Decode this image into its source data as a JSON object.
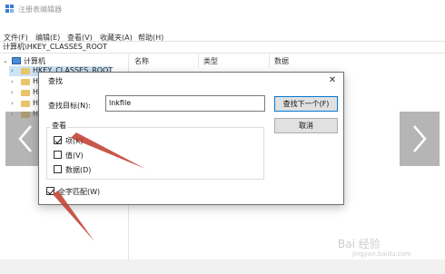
{
  "window": {
    "title": "注册表编辑器",
    "menu": [
      "文件(F)",
      "编辑(E)",
      "查看(V)",
      "收藏夹(A)",
      "帮助(H)"
    ],
    "address": "计算机\\HKEY_CLASSES_ROOT"
  },
  "tree": {
    "root": "计算机",
    "selected": "HKEY_CLASSES_ROOT",
    "truncated": [
      "H",
      "H",
      "H",
      "H"
    ]
  },
  "list": {
    "headers": [
      "名称",
      "类型",
      "数据"
    ]
  },
  "dialog": {
    "title": "查找",
    "close_glyph": "✕",
    "find_label": "查找目标(N):",
    "find_value": "lnkfile",
    "find_next_button": "查找下一个(F)",
    "cancel_button": "取消",
    "look_at_label": "查看",
    "options": [
      {
        "label": "项(K)",
        "checked": true
      },
      {
        "label": "值(V)",
        "checked": false
      },
      {
        "label": "数据(D)",
        "checked": false
      }
    ],
    "match_whole": {
      "label": "全字匹配(W)",
      "checked": true
    }
  },
  "icons": {
    "app": "registry-icon",
    "prev": "chevron-left-icon",
    "next": "chevron-right-icon"
  },
  "colors": {
    "annotation_arrow": "#c0392b",
    "selection": "#cce4f7",
    "folder": "#e9c46a",
    "primary_border": "#0078d7"
  },
  "watermark": {
    "main": "Bai 经验",
    "sub": "jingyan.baidu.com"
  }
}
